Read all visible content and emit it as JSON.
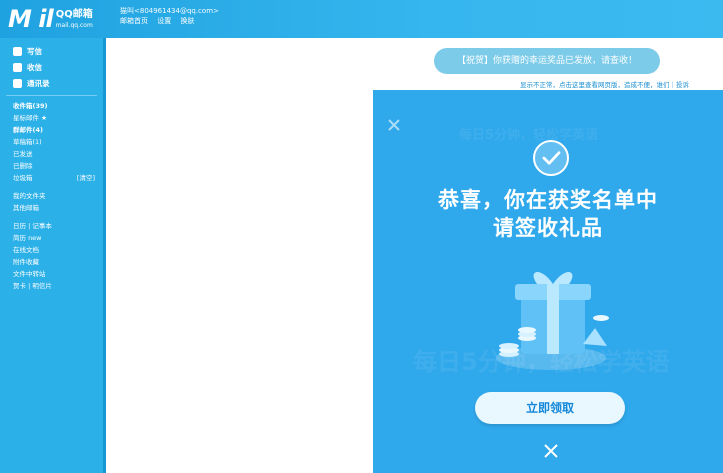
{
  "header": {
    "logo_mark": "M il",
    "logo_cn": "QQ邮箱",
    "logo_domain": "mail.qq.com",
    "user_email": "猫叫<804961434@qq.com>",
    "links": [
      "邮箱首页",
      "设置",
      "换肤"
    ]
  },
  "sidebar": {
    "actions": [
      "写信",
      "收信",
      "通讯录"
    ],
    "folders": [
      {
        "label": "收件箱(39)",
        "bold": true
      },
      {
        "label": "星标邮件 ★",
        "bold": false
      },
      {
        "label": "群邮件(4)",
        "bold": true
      },
      {
        "label": "草稿箱(1)",
        "bold": false
      },
      {
        "label": "已发送",
        "bold": false
      },
      {
        "label": "已删除",
        "bold": false
      },
      {
        "label": "垃圾箱",
        "bold": false,
        "extra": "[清空]"
      }
    ],
    "section": [
      "我的文件夹",
      "其他邮箱"
    ],
    "tools": [
      "日历 | 记事本",
      "简历 new",
      "在线文档",
      "附件收藏",
      "文件中转站",
      "贺卡 | 明信片"
    ]
  },
  "main": {
    "notice": "【祝贺】你获赠的幸运奖品已发放，请查收！",
    "subnotice": "显示不正常，点击这里查看网页版，造成不便，谁们｜投诉"
  },
  "popup": {
    "title_line1": "恭喜，你在获奖名单中",
    "title_line2": "请签收礼品",
    "claim_button": "立即领取",
    "bg_text_1": "每日5分钟，轻松学英语",
    "bg_text_2": "每日5分钟，轻松学英语",
    "colors": {
      "bg": "#2fa8ec",
      "button_text": "#1488d9"
    }
  }
}
